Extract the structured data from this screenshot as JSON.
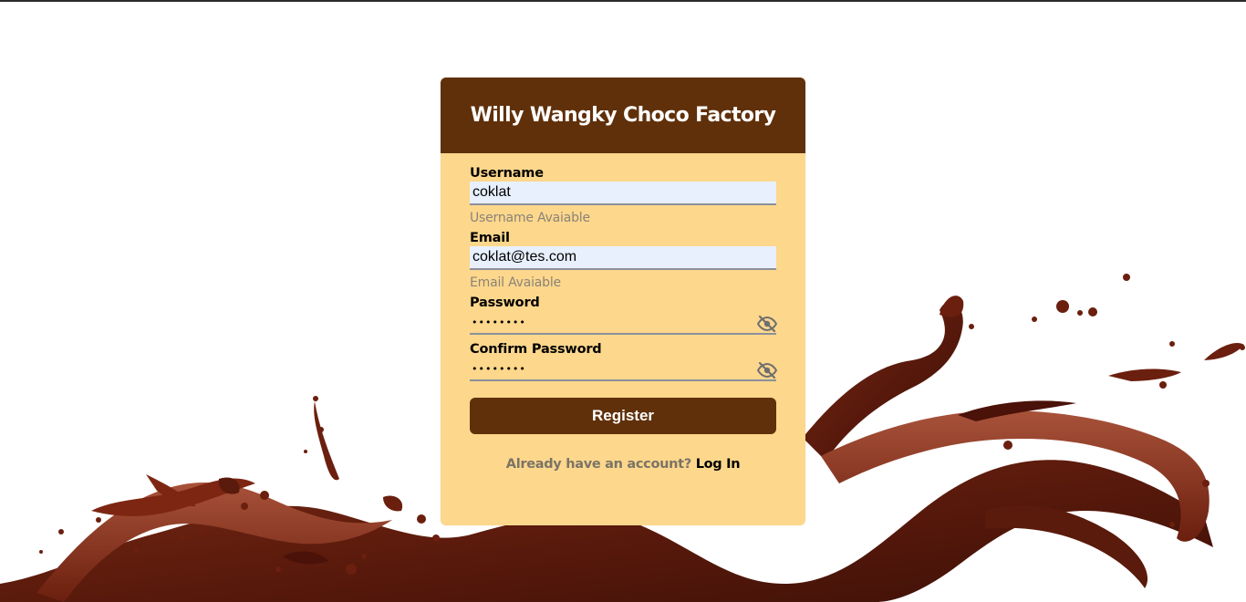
{
  "app": {
    "title": "Willy Wangky Choco Factory"
  },
  "form": {
    "username": {
      "label": "Username",
      "value": "coklat",
      "status": "Username Avaiable"
    },
    "email": {
      "label": "Email",
      "value": "coklat@tes.com",
      "status": "Email Avaiable"
    },
    "password": {
      "label": "Password",
      "value": "••••••••",
      "icon": "eye-slash-icon"
    },
    "confirm_password": {
      "label": "Confirm Password",
      "value": "••••••••",
      "icon": "eye-slash-icon"
    },
    "register_label": "Register"
  },
  "footer": {
    "prompt": "Already have an account?",
    "login_label": "Log In"
  },
  "colors": {
    "header_brown": "#60300a",
    "card_background": "#fdd78c",
    "input_fill": "#e8f0fe",
    "hint_gray": "#8a8478",
    "chocolate": "#6b1f0e"
  }
}
